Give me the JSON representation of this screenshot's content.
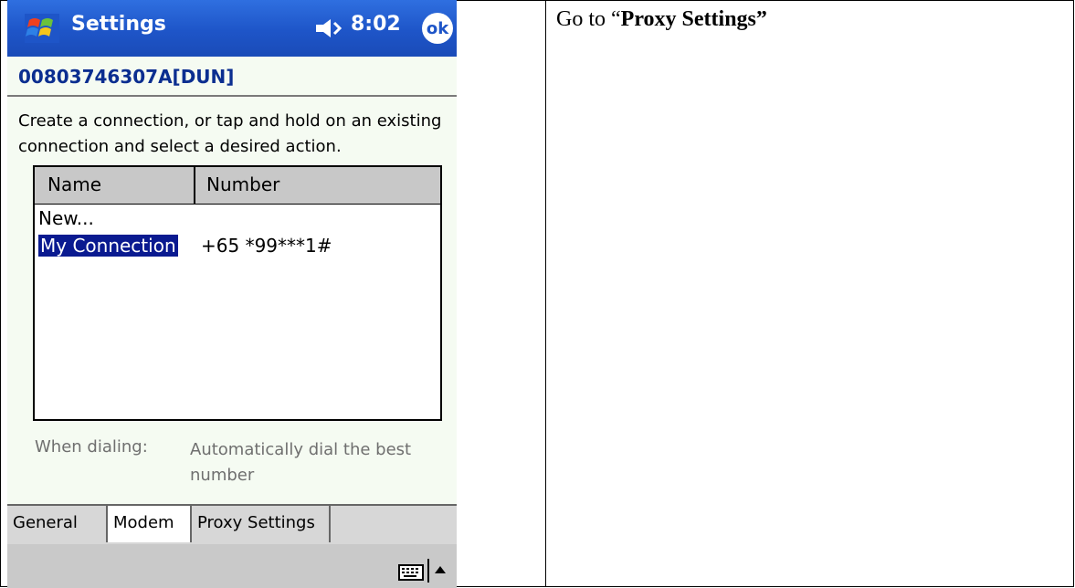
{
  "instruction": {
    "prefix": "Go to “",
    "emphasis": "Proxy Settings”"
  },
  "ppc": {
    "title": "Settings",
    "time": "8:02",
    "ok": "ok",
    "connection_title": "00803746307A[DUN]",
    "help_text": "Create a connection, or tap and hold on an existing connection and select a desired action.",
    "list": {
      "columns": [
        "Name",
        "Number"
      ],
      "new_item": "New...",
      "rows": [
        {
          "name": "My Connection",
          "number": "+65 *99***1#"
        }
      ]
    },
    "dialing": {
      "label": "When dialing:",
      "value": "Automatically dial the best number"
    },
    "tabs": [
      "General",
      "Modem",
      "Proxy Settings"
    ]
  },
  "colors": {
    "titlebar": "#1e55c8",
    "selection": "#0a1a90",
    "connection_title": "#0b2e90"
  },
  "icons": {
    "start": "windows-flag-icon",
    "speaker": "speaker-icon",
    "keyboard": "keyboard-icon",
    "sip_arrow": "up-arrow-icon"
  }
}
